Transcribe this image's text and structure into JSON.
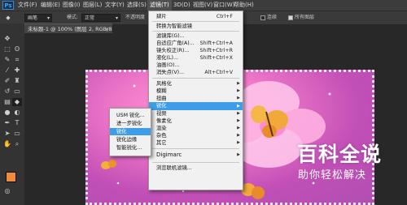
{
  "menubar": {
    "logo": "Ps",
    "items": [
      "文件(F)",
      "编辑(E)",
      "图像(I)",
      "图层(L)",
      "文字(Y)",
      "选择(S)",
      "滤镜(T)",
      "3D(D)",
      "视图(V)",
      "窗口(W)",
      "帮助(H)"
    ]
  },
  "options": {
    "preset": "画笔",
    "mode_label": "模式:",
    "mode_value": "正常",
    "opacity_label": "不透明度",
    "smooth_label": "连续",
    "all_layers_label": "所有图层"
  },
  "document": {
    "tab_title": "未标题-1 @ 100% (图层 2, RGB/8) *",
    "close": "×"
  },
  "filter_menu": {
    "rows": [
      {
        "label": "肆片",
        "shortcut": "Ctrl+F"
      },
      {
        "label": "转换为智能滤镜",
        "shortcut": ""
      },
      {
        "label": "滤镜库(G)...",
        "shortcut": ""
      },
      {
        "label": "自适应广角(A)...",
        "shortcut": "Shift+Ctrl+A"
      },
      {
        "label": "镜头校正(R)...",
        "shortcut": "Shift+Ctrl+R"
      },
      {
        "label": "液化(L)...",
        "shortcut": "Shift+Ctrl+X"
      },
      {
        "label": "油画(O)...",
        "shortcut": ""
      },
      {
        "label": "消失点(V)...",
        "shortcut": "Alt+Ctrl+V"
      },
      {
        "label": "风格化",
        "shortcut": ""
      },
      {
        "label": "模糊",
        "shortcut": ""
      },
      {
        "label": "扭曲",
        "shortcut": ""
      },
      {
        "label": "锐化",
        "shortcut": ""
      },
      {
        "label": "视频",
        "shortcut": ""
      },
      {
        "label": "像素化",
        "shortcut": ""
      },
      {
        "label": "渲染",
        "shortcut": ""
      },
      {
        "label": "杂色",
        "shortcut": ""
      },
      {
        "label": "其它",
        "shortcut": ""
      },
      {
        "label": "Digimarc",
        "shortcut": ""
      },
      {
        "label": "浏览联机滤镜...",
        "shortcut": ""
      }
    ],
    "highlighted": "锐化"
  },
  "sharpen_submenu": {
    "rows": [
      "USM 锐化...",
      "进一步锐化",
      "锐化",
      "锐化边缘",
      "智能锐化..."
    ],
    "highlighted": "锐化"
  },
  "watermark": {
    "title": "百科全说",
    "subtitle": "助你轻松解决"
  },
  "colors": {
    "highlight": "#3e9de6",
    "foreground_swatch": "#f08a3c",
    "background_swatch": "#ffffff"
  },
  "icons": [
    "move-icon",
    "marquee-icon",
    "lasso-icon",
    "quick-select-icon",
    "crop-icon",
    "eyedropper-icon",
    "healing-icon",
    "brush-icon",
    "stamp-icon",
    "history-brush-icon",
    "eraser-icon",
    "gradient-icon",
    "blur-icon",
    "dodge-icon",
    "pen-icon",
    "type-icon",
    "path-select-icon",
    "shape-icon",
    "hand-icon",
    "zoom-icon"
  ]
}
